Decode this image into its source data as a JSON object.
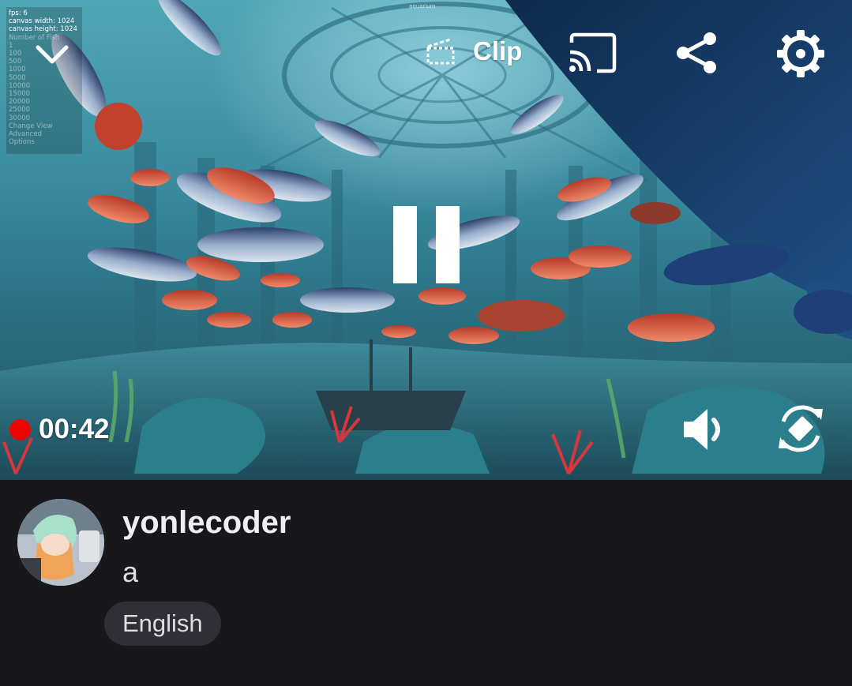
{
  "player": {
    "overlay_title": "aquarium",
    "stats": {
      "lines": [
        "fps: 6",
        "canvas width: 1024",
        "canvas height: 1024"
      ],
      "dim_lines": [
        "Number of Fish",
        "1",
        "100",
        "500",
        "1000",
        "5000",
        "10000",
        "15000",
        "20000",
        "25000",
        "30000",
        "Change View",
        "Advanced",
        "Options"
      ]
    },
    "icons": {
      "collapse": "chevron-down-icon",
      "clip": "clapperboard-icon",
      "cast": "cast-icon",
      "share": "share-icon",
      "settings": "gear-icon",
      "pause": "pause-icon",
      "volume": "volume-icon",
      "rotate": "rotate-screen-icon"
    },
    "clip_label": "Clip",
    "timer": "00:42",
    "live_color": "#eb0400"
  },
  "channel": {
    "name": "yonlecoder",
    "title": "a",
    "tags": [
      "English"
    ]
  }
}
